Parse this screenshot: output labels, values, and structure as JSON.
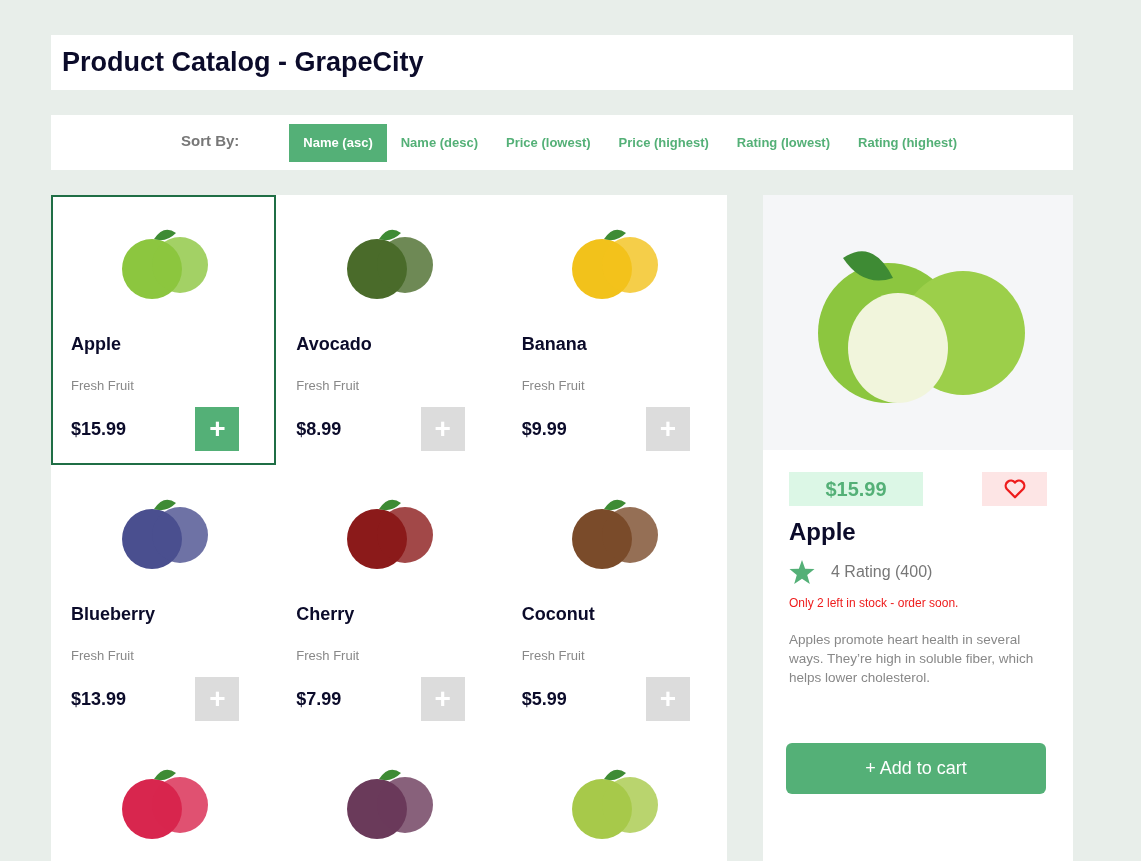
{
  "title": "Product Catalog - GrapeCity",
  "sort": {
    "label": "Sort By:",
    "options": [
      {
        "label": "Name (asc)",
        "selected": true
      },
      {
        "label": "Name (desc)",
        "selected": false
      },
      {
        "label": "Price (lowest)",
        "selected": false
      },
      {
        "label": "Price (highest)",
        "selected": false
      },
      {
        "label": "Rating (lowest)",
        "selected": false
      },
      {
        "label": "Rating (highest)",
        "selected": false
      }
    ]
  },
  "products": [
    {
      "name": "Apple",
      "category": "Fresh Fruit",
      "price": "$15.99",
      "selected": true,
      "add_label": "+"
    },
    {
      "name": "Avocado",
      "category": "Fresh Fruit",
      "price": "$8.99",
      "selected": false,
      "add_label": "+"
    },
    {
      "name": "Banana",
      "category": "Fresh Fruit",
      "price": "$9.99",
      "selected": false,
      "add_label": "+"
    },
    {
      "name": "Blueberry",
      "category": "Fresh Fruit",
      "price": "$13.99",
      "selected": false,
      "add_label": "+"
    },
    {
      "name": "Cherry",
      "category": "Fresh Fruit",
      "price": "$7.99",
      "selected": false,
      "add_label": "+"
    },
    {
      "name": "Coconut",
      "category": "Fresh Fruit",
      "price": "$5.99",
      "selected": false,
      "add_label": "+"
    },
    {
      "selected": false
    },
    {
      "selected": false
    },
    {
      "selected": false
    }
  ],
  "detail": {
    "price": "$15.99",
    "name": "Apple",
    "rating": "4 Rating (400)",
    "stock": "Only 2 left in stock - order soon.",
    "description": "Apples promote heart health in several ways. They’re high in soluble fiber, which helps lower cholesterol.",
    "button": "+ Add to cart"
  }
}
